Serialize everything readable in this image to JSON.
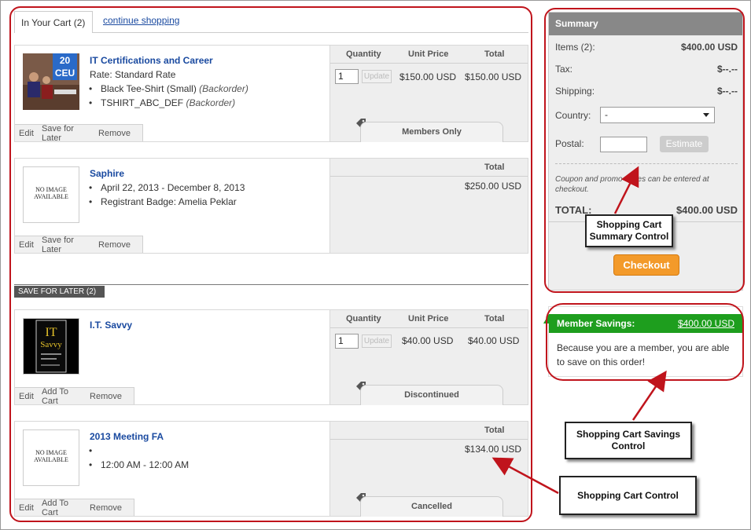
{
  "tabs": {
    "active_label": "In Your Cart (2)",
    "continue_label": "continue shopping"
  },
  "columns": {
    "quantity": "Quantity",
    "unit_price": "Unit Price",
    "total": "Total"
  },
  "update_label": "Update",
  "cart_items": [
    {
      "title": "IT Certifications and Career",
      "badge_number": "20",
      "badge_text": "CEU",
      "rate": "Rate: Standard Rate",
      "options": [
        {
          "name": "Black Tee-Shirt (Small)",
          "status": "(Backorder)"
        },
        {
          "name": "TSHIRT_ABC_DEF",
          "status": "(Backorder)"
        }
      ],
      "quantity": "1",
      "unit_price": "$150.00 USD",
      "total": "$150.00 USD",
      "tag": "Members Only",
      "actions": [
        "Edit",
        "Save for Later",
        "Remove"
      ]
    },
    {
      "title": "Saphire",
      "image_text": "NO IMAGE AVAILABLE",
      "bullets": [
        "April 22, 2013 - December 8, 2013",
        "Registrant Badge: Amelia Peklar"
      ],
      "total": "$250.00 USD",
      "actions": [
        "Edit",
        "Save for Later",
        "Remove"
      ]
    }
  ],
  "save_for_later": {
    "label": "SAVE FOR LATER (2)",
    "items": [
      {
        "title": "I.T. Savvy",
        "quantity": "1",
        "unit_price": "$40.00 USD",
        "total": "$40.00 USD",
        "tag": "Discontinued",
        "actions": [
          "Edit",
          "Add To Cart",
          "Remove"
        ]
      },
      {
        "title": "2013 Meeting FA",
        "image_text": "NO IMAGE AVAILABLE",
        "bullets": [
          "",
          "12:00 AM - 12:00 AM"
        ],
        "total": "$134.00 USD",
        "tag": "Cancelled",
        "actions": [
          "Edit",
          "Add To Cart",
          "Remove"
        ]
      }
    ]
  },
  "summary": {
    "title": "Summary",
    "items_label": "Items (2):",
    "items_value": "$400.00 USD",
    "tax_label": "Tax:",
    "tax_value": "$--.--",
    "shipping_label": "Shipping:",
    "shipping_value": "$--.--",
    "country_label": "Country:",
    "country_value": "-",
    "postal_label": "Postal:",
    "estimate_label": "Estimate",
    "coupon_note": "Coupon and promo codes can be entered at checkout.",
    "total_label": "TOTAL:",
    "total_value": "$400.00 USD",
    "checkout_label": "Checkout"
  },
  "member_savings": {
    "label": "Member Savings:",
    "amount": "$400.00 USD",
    "message": "Because you are a member, you are able to save on this order!"
  },
  "annotations": {
    "summary_control": "Shopping Cart Summary Control",
    "savings_control": "Shopping Cart Savings Control",
    "cart_control": "Shopping Cart Control"
  },
  "colors": {
    "annotation_red": "#c0141c",
    "member_green": "#1e9e1e",
    "checkout_orange": "#f39a2a",
    "link_blue": "#1a4aa0"
  }
}
